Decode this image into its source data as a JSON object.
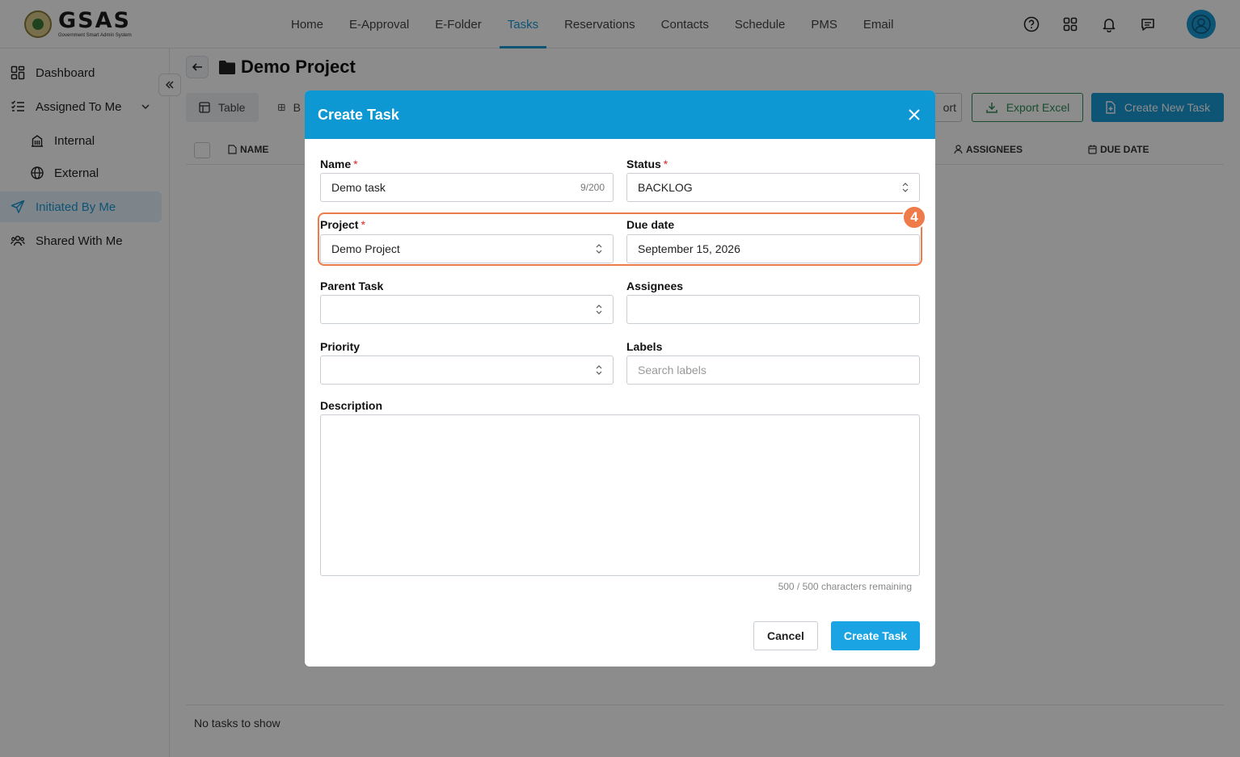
{
  "app": {
    "logo_title": "GSAS",
    "logo_subtitle": "Government Smart Admin System"
  },
  "nav": {
    "items": [
      "Home",
      "E-Approval",
      "E-Folder",
      "Tasks",
      "Reservations",
      "Contacts",
      "Schedule",
      "PMS",
      "Email"
    ],
    "active": "Tasks"
  },
  "sidebar": {
    "dashboard": "Dashboard",
    "assigned_to_me": "Assigned To Me",
    "internal": "Internal",
    "external": "External",
    "initiated_by_me": "Initiated By Me",
    "shared_with_me": "Shared With Me"
  },
  "page": {
    "title": "Demo Project",
    "tab_table": "Table",
    "tab_board": "B",
    "import_label": "ort",
    "export_label": "Export Excel",
    "create_new_label": "Create New Task",
    "col_name": "NAME",
    "col_assignees": "ASSIGNEES",
    "col_due": "DUE DATE",
    "empty": "No tasks to show"
  },
  "modal": {
    "title": "Create Task",
    "name_label": "Name",
    "name_value": "Demo task",
    "name_count": "9/200",
    "status_label": "Status",
    "status_value": "BACKLOG",
    "project_label": "Project",
    "project_value": "Demo Project",
    "due_label": "Due date",
    "due_value": "September 15, 2026",
    "parent_label": "Parent Task",
    "assignees_label": "Assignees",
    "priority_label": "Priority",
    "labels_label": "Labels",
    "labels_placeholder": "Search labels",
    "description_label": "Description",
    "remaining": "500 / 500 characters remaining",
    "cancel": "Cancel",
    "create": "Create Task",
    "required_mark": "*",
    "step_badge": "4"
  },
  "colors": {
    "accent": "#1a9ad6",
    "modal_header": "#0d97d3",
    "highlight": "#f07b4a",
    "export_green": "#2e8b57"
  }
}
